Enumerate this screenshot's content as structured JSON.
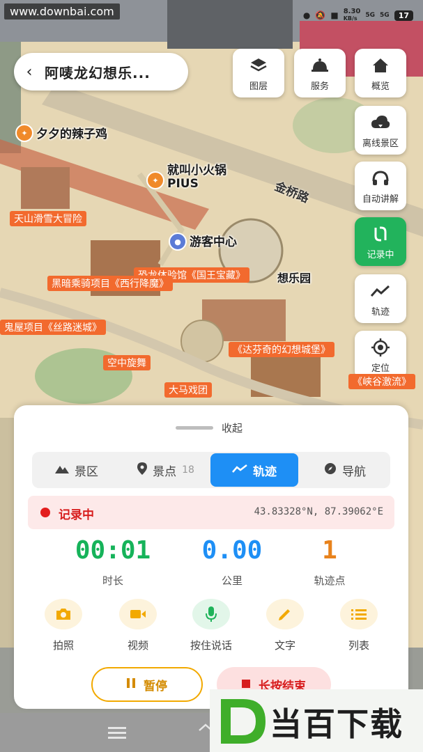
{
  "status_bar": {
    "watermark": "www.downbai.com",
    "speed_value": "8.30",
    "speed_unit": "KB/s",
    "signal_1": "5G",
    "signal_2": "5G",
    "battery": "17"
  },
  "header": {
    "title": "阿唛龙幻想乐..."
  },
  "toolbar": {
    "layers_label": "图层",
    "services_label": "服务",
    "overview_label": "概览",
    "offline_label": "离线景区",
    "audio_guide_label": "自动讲解",
    "recording_label": "记录中",
    "track_label": "轨迹",
    "locate_label": "定位"
  },
  "map": {
    "road_label": "金桥路",
    "pois": [
      "夕夕的辣子鸡",
      "就叫小火锅",
      "PIUS",
      "天山滑雪大冒险",
      "游客中心",
      "恐龙体验馆《国王宝藏》",
      "黑暗乘骑项目《西行降魔》",
      "想乐园",
      "鬼屋项目《丝路迷城》",
      "《达芬奇的幻想城堡》",
      "空中旋舞",
      "大马戏团",
      "《峡谷激流》"
    ]
  },
  "sheet": {
    "collapse_label": "收起",
    "tabs": [
      {
        "label": "景区",
        "count": ""
      },
      {
        "label": "景点",
        "count": "18"
      },
      {
        "label": "轨迹",
        "count": ""
      },
      {
        "label": "导航",
        "count": ""
      }
    ],
    "active_tab": "轨迹",
    "recording": {
      "status": "记录中",
      "coords": "43.83328°N, 87.39062°E"
    },
    "stats": [
      {
        "value": "00:01",
        "label": "时长",
        "color": "#16b35a"
      },
      {
        "value": "0.00",
        "label": "公里",
        "color": "#1e8ff5"
      },
      {
        "value": "1",
        "label": "轨迹点",
        "color": "#e8821c"
      }
    ],
    "actions": [
      {
        "label": "拍照",
        "icon": "camera-icon",
        "color": "#f2a900"
      },
      {
        "label": "视频",
        "icon": "video-icon",
        "color": "#f2a900"
      },
      {
        "label": "按住说话",
        "icon": "microphone-icon",
        "color": "#1fb35a"
      },
      {
        "label": "文字",
        "icon": "pencil-icon",
        "color": "#f2a900"
      },
      {
        "label": "列表",
        "icon": "list-icon",
        "color": "#f2a900"
      }
    ],
    "pause_label": "暂停",
    "end_label": "长按结束"
  },
  "watermark_logo": "当百下载"
}
